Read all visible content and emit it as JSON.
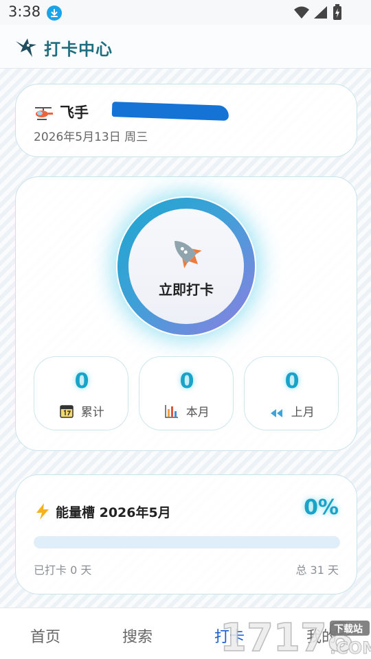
{
  "status_bar": {
    "time": "3:38"
  },
  "header": {
    "title": "打卡中心"
  },
  "user": {
    "name": "飞手",
    "date": "2026年5月13日 周三"
  },
  "checkin": {
    "button_label": "立即打卡",
    "stats": [
      {
        "value": "0",
        "label": "累计",
        "icon": "calendar-icon"
      },
      {
        "value": "0",
        "label": "本月",
        "icon": "bar-chart-icon"
      },
      {
        "value": "0",
        "label": "上月",
        "icon": "rewind-icon"
      }
    ]
  },
  "energy": {
    "title": "能量槽 2026年5月",
    "percent": "0%",
    "progress": 0,
    "done_text": "已打卡 0 天",
    "total_text": "总 31 天"
  },
  "nav": {
    "items": [
      {
        "label": "首页"
      },
      {
        "label": "搜索"
      },
      {
        "label": "打卡"
      },
      {
        "label": "我的"
      }
    ],
    "active": "打卡"
  },
  "watermark": {
    "text": "17178",
    "tag": "下载站",
    "suffix": ".COM"
  },
  "colors": {
    "accent": "#1aa3c8",
    "nav_active": "#1a5fd6",
    "title": "#1f6e80"
  }
}
